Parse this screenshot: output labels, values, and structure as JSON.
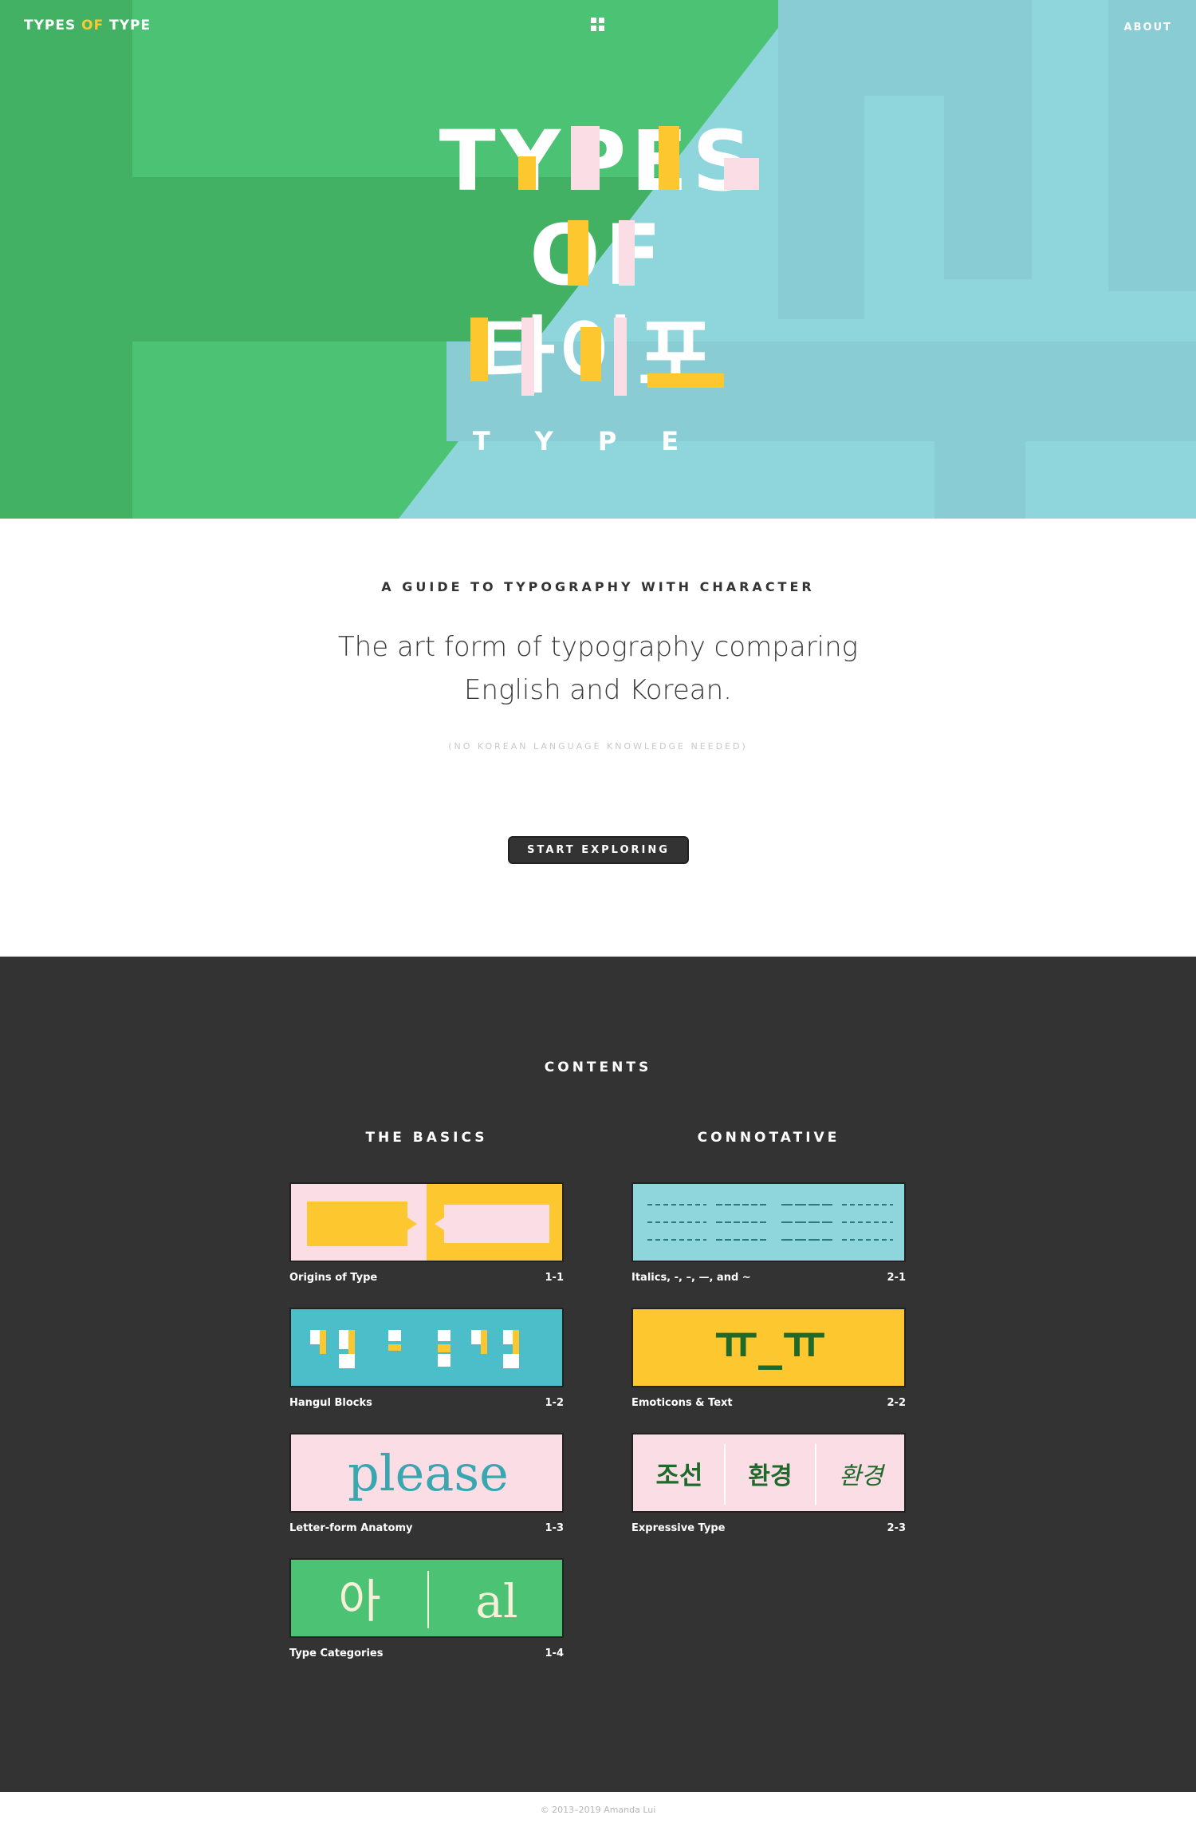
{
  "header": {
    "logo": {
      "part1": "TYPES ",
      "part2": "OF",
      "part3": " TYPE"
    },
    "menu_icon": "grid-icon",
    "about_label": "ABOUT"
  },
  "hero": {
    "line1": "TYPES",
    "line2": "OF",
    "line3": "타이포",
    "line4": "TYPE",
    "colors": {
      "green": "#4cc275",
      "dark_green": "#42b164",
      "teal": "#8fd6dc",
      "yellow": "#fdc82f",
      "pink": "#fbdde6",
      "white": "#ffffff"
    }
  },
  "intro": {
    "kicker": "A GUIDE TO TYPOGRAPHY WITH CHARACTER",
    "lede": "The art form of typography comparing English and Korean.",
    "note": "(NO KOREAN LANGUAGE KNOWLEDGE NEEDED)",
    "cta_label": "START EXPLORING"
  },
  "contents": {
    "title": "CONTENTS",
    "columns": [
      {
        "title": "THE BASICS",
        "items": [
          {
            "label": "Origins of Type",
            "number": "1-1"
          },
          {
            "label": "Hangul Blocks",
            "number": "1-2"
          },
          {
            "label": "Letter-form Anatomy",
            "number": "1-3",
            "thumb_text": "please"
          },
          {
            "label": "Type Categories",
            "number": "1-4",
            "thumb_left": "아",
            "thumb_right": "al"
          }
        ]
      },
      {
        "title": "CONNOTATIVE",
        "items": [
          {
            "label": "Italics, -, –, —, and ~",
            "number": "2-1"
          },
          {
            "label": "Emoticons & Text",
            "number": "2-2",
            "thumb_text": "ㅠ_ㅠ"
          },
          {
            "label": "Expressive Type",
            "number": "2-3",
            "thumb_words": [
              "조선",
              "환경",
              "환경"
            ]
          }
        ]
      }
    ]
  },
  "footer": {
    "copyright": "© 2013–2019 Amanda Lui"
  }
}
